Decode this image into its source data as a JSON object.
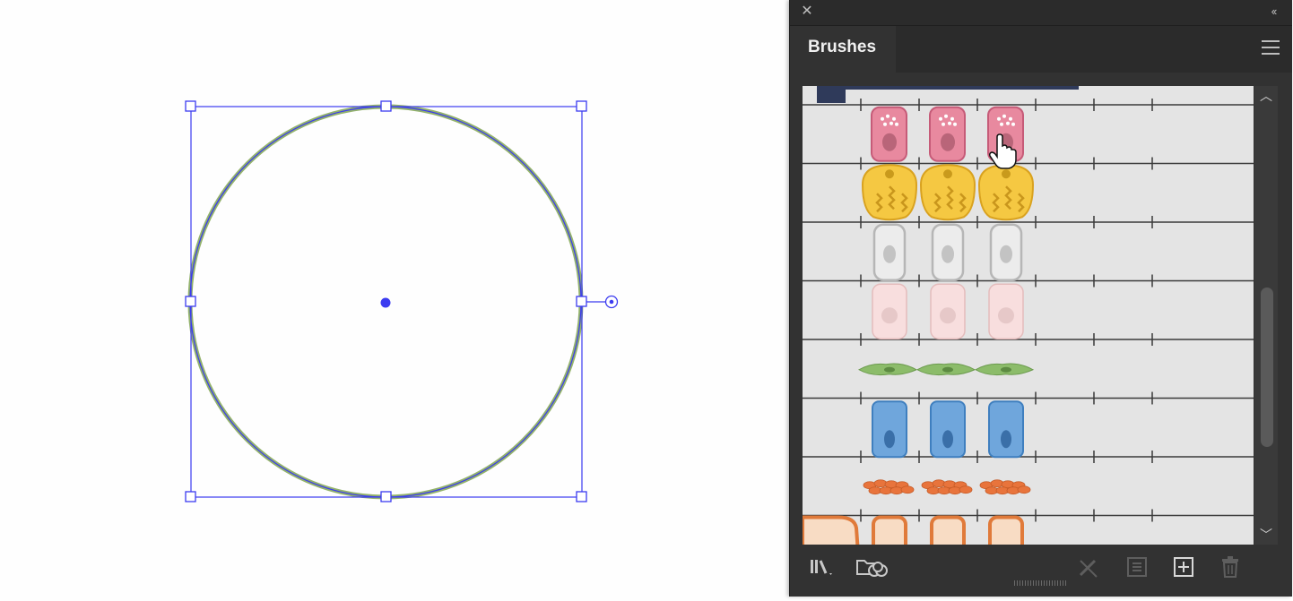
{
  "panel": {
    "close_glyph": "✕",
    "collapse_glyph": "‹‹",
    "tab_label": "Brushes",
    "menu_icon": "hamburger-menu-icon"
  },
  "brushes": [
    {
      "name": "pink-dotted-cell-brush",
      "fill": "#e8899f",
      "stroke": "#c65b78"
    },
    {
      "name": "yellow-cell-brush",
      "fill": "#f5c842",
      "stroke": "#d9a21f"
    },
    {
      "name": "gray-outline-cell-brush",
      "fill": "#ececec",
      "stroke": "#b6b6b6"
    },
    {
      "name": "light-pink-cell-brush",
      "fill": "#f8dede",
      "stroke": "#e4bcbc"
    },
    {
      "name": "green-spindle-cell-brush",
      "fill": "#8cbc6a",
      "stroke": "#6b9a4d"
    },
    {
      "name": "blue-cell-brush",
      "fill": "#6fa6dc",
      "stroke": "#3f7fbf"
    },
    {
      "name": "orange-blood-cell-brush",
      "fill": "#e8743c",
      "stroke": "#c45a26"
    },
    {
      "name": "orange-frame-cell-brush",
      "fill": "#f8dcc4",
      "stroke": "#e07a3a"
    }
  ],
  "bottom_bar": {
    "icons": [
      "brush-libraries-menu-icon",
      "libraries-panel-icon",
      "remove-brush-stroke-icon",
      "brush-options-icon",
      "new-brush-icon",
      "delete-brush-icon"
    ]
  },
  "colors": {
    "selection": "#3b3bf0",
    "circle_stroke": "#93b26c",
    "panel_bg": "#323232",
    "list_bg": "#e4e4e4"
  }
}
